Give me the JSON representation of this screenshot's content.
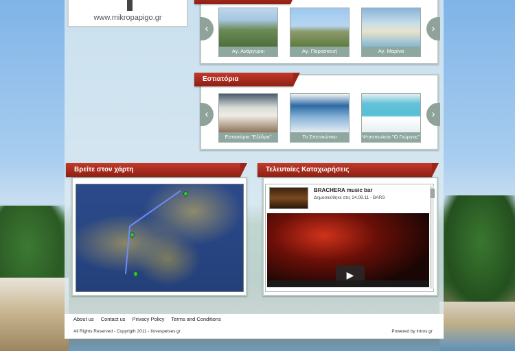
{
  "logo": {
    "url_text": "www.mikropapigo.gr"
  },
  "top_gallery": {
    "prev_icon": "chevron-left-icon",
    "next_icon": "chevron-right-icon",
    "items": [
      {
        "caption": "Αγ. Ανάργυροι"
      },
      {
        "caption": "Αγ. Παρασκευή"
      },
      {
        "caption": "Αγ. Μαρίνα"
      }
    ]
  },
  "restaurants": {
    "title": "Εστιατόρια",
    "items": [
      {
        "caption": "Εστιατόριο \"Εξέδρα\""
      },
      {
        "caption": "Το Σπετσιώτικο"
      },
      {
        "caption": "Ψητοπωλείο \"Ο Γιώργος\""
      }
    ]
  },
  "map_section": {
    "title": "Βρείτε στον χάρτη"
  },
  "latest": {
    "title": "Τελευταίες Καταχωρήσεις",
    "entry_title": "BRACHERA music bar",
    "entry_meta": "Δημοσιεύθηκε στις 24.08.11 - BARS"
  },
  "footer": {
    "links": [
      "About us",
      "Contact us",
      "Privacy Policy",
      "Terms and Conditions"
    ],
    "copyright": "All Rights Reserved - Copyrigth 2011 - Ilovespetses.gr",
    "powered": "Powered by intros.gr"
  },
  "colors": {
    "ribbon": "#a82a1c",
    "panel_border": "#bcc8c4",
    "caption_bg": "#8ea79f"
  }
}
